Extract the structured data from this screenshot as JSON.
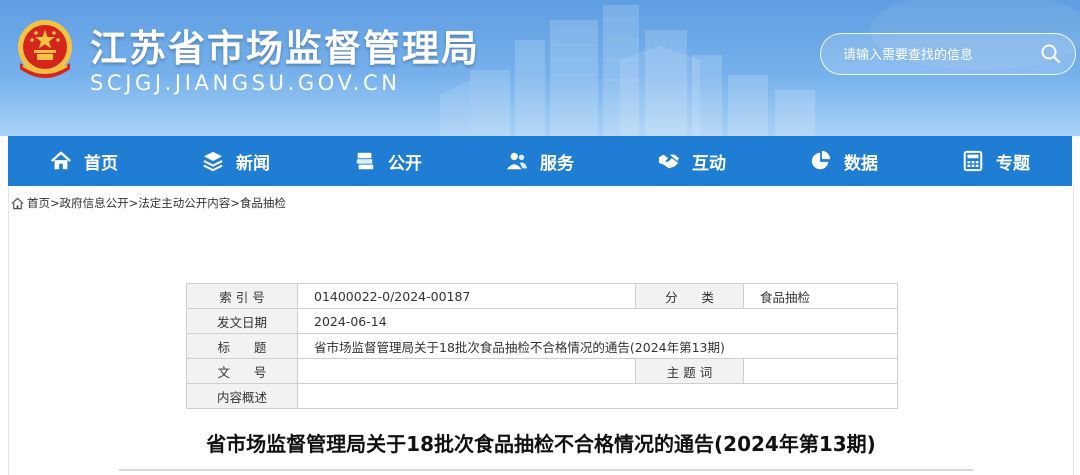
{
  "header": {
    "title": "江苏省市场监督管理局",
    "domain": "SCJGJ.JIANGSU.GOV.CN",
    "search_placeholder": "请输入需要查找的信息",
    "colors": {
      "header_blue": "#6aa8e8",
      "nav_blue": "#1f7ed3"
    }
  },
  "nav": {
    "items": [
      {
        "label": "首页",
        "icon": "home-icon"
      },
      {
        "label": "新闻",
        "icon": "layers-icon"
      },
      {
        "label": "公开",
        "icon": "document-stack-icon"
      },
      {
        "label": "服务",
        "icon": "people-icon"
      },
      {
        "label": "互动",
        "icon": "handshake-icon"
      },
      {
        "label": "数据",
        "icon": "pie-chart-icon"
      },
      {
        "label": "专题",
        "icon": "calculator-icon"
      }
    ]
  },
  "breadcrumb": {
    "items": [
      "首页",
      "政府信息公开",
      "法定主动公开内容",
      "食品抽检"
    ],
    "separator": ">"
  },
  "info_table": {
    "index_label": "索 引 号",
    "index_value": "01400022-0/2024-00187",
    "category_label": "分      类",
    "category_value": "食品抽检",
    "date_label": "发文日期",
    "date_value": "2024-06-14",
    "title_label": "标      题",
    "title_value": "省市场监督管理局关于18批次食品抽检不合格情况的通告(2024年第13期)",
    "docno_label": "文      号",
    "docno_value": "",
    "subject_label": "主 题 词",
    "subject_value": "",
    "summary_label": "内容概述",
    "summary_value": ""
  },
  "article": {
    "title": "省市场监督管理局关于18批次食品抽检不合格情况的通告(2024年第13期)"
  }
}
